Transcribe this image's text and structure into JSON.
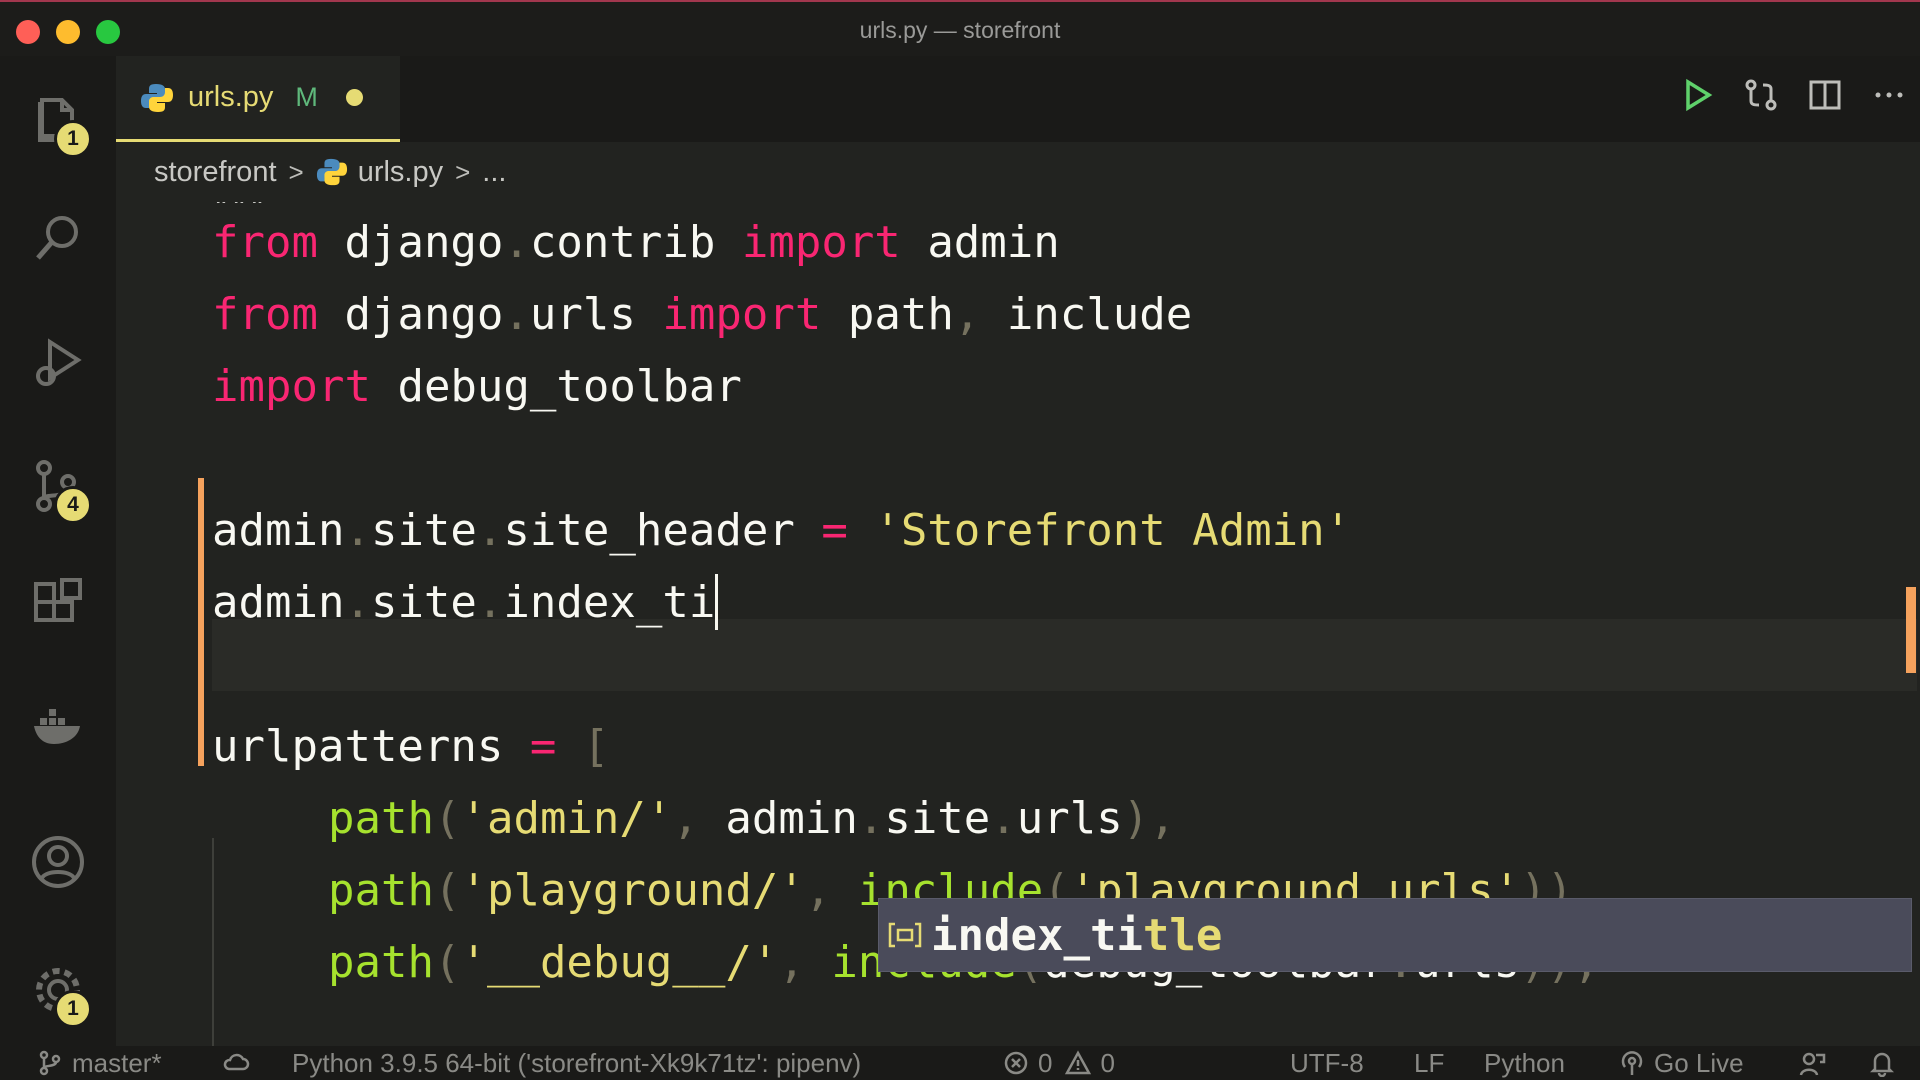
{
  "window": {
    "title": "urls.py — storefront"
  },
  "activity_bar": {
    "explorer_badge": "1",
    "source_control_badge": "4",
    "settings_badge": "1"
  },
  "tab": {
    "label": "urls.py",
    "status": "M"
  },
  "breadcrumb": {
    "folder": "storefront",
    "file": "urls.py",
    "more": "..."
  },
  "editor": {
    "docstring_end": "\"\"\"",
    "line1": {
      "from": "from",
      "module": "django",
      "dot": ".",
      "sub": "contrib",
      "import": "import",
      "name": "admin"
    },
    "line2": {
      "from": "from",
      "module": "django",
      "dot": ".",
      "sub": "urls",
      "import": "import",
      "names": "path",
      "comma": ",",
      "name2": "include"
    },
    "line3": {
      "import": "import",
      "name": "debug_toolbar"
    },
    "line4": {
      "obj": "admin",
      "attr1": "site",
      "attr2": "site_header",
      "eq": "=",
      "value": "'Storefront Admin'"
    },
    "line5": {
      "obj": "admin",
      "attr1": "site",
      "attr2": "index_ti"
    },
    "line6": {
      "name": "urlpatterns",
      "eq": "=",
      "bracket": "["
    },
    "line7": {
      "fn": "path",
      "open": "(",
      "arg": "'admin/'",
      "sep": ", ",
      "obj": "admin",
      "attr1": "site",
      "attr2": "urls",
      "close": "),",
      "dot": "."
    },
    "line8": {
      "fn": "path",
      "open": "(",
      "arg": "'playground/'",
      "sep": ", ",
      "fn2": "include",
      "arg2": "'playground.urls'",
      "close": ")),"
    },
    "line9": {
      "fn": "path",
      "open": "(",
      "arg": "'__debug__/'",
      "sep": ", ",
      "fn2": "include",
      "arg2": "debug_toolbar",
      "dot": ".",
      "attr": "urls",
      "close": ")),"
    }
  },
  "suggestion": {
    "match": "index_ti",
    "rest": "tle"
  },
  "statusbar": {
    "branch": "master*",
    "interpreter": "Python 3.9.5 64-bit ('storefront-Xk9k71tz': pipenv)",
    "errors": "0",
    "warnings": "0",
    "encoding": "UTF-8",
    "eol": "LF",
    "language": "Python",
    "live": "Go Live"
  },
  "colors": {
    "keyword": "#f92672",
    "string": "#e6db74",
    "function": "#a6e22e",
    "git_modified": "#f5a25d"
  }
}
